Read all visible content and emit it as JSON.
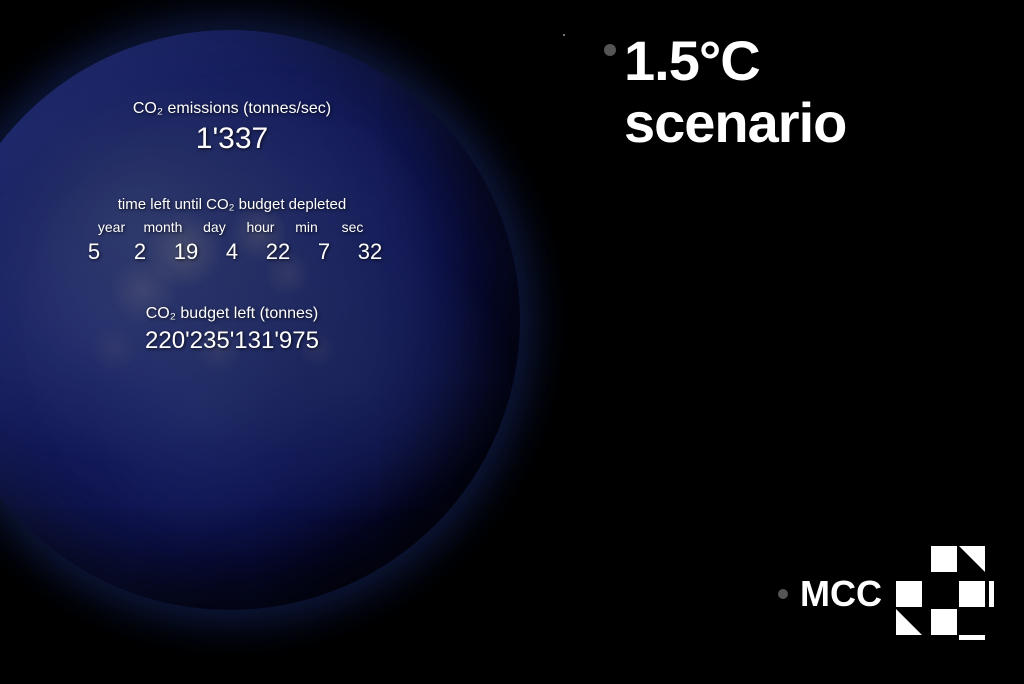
{
  "scenario": {
    "title": "1.5°C scenario",
    "title_dot_color": "#555"
  },
  "emissions": {
    "label": "CO₂ emissions (tonnes/sec)",
    "value": "1'337"
  },
  "countdown": {
    "label": "time left until CO₂ budget depleted",
    "headers": [
      "year",
      "month",
      "day",
      "hour",
      "min",
      "sec"
    ],
    "values": [
      "5",
      "2",
      "19",
      "4",
      "22",
      "7",
      "32"
    ]
  },
  "budget": {
    "label": "CO₂ budget left (tonnes)",
    "value": "220'235'131'975"
  },
  "mcc": {
    "label": "MCC",
    "dot_color": "#555"
  }
}
